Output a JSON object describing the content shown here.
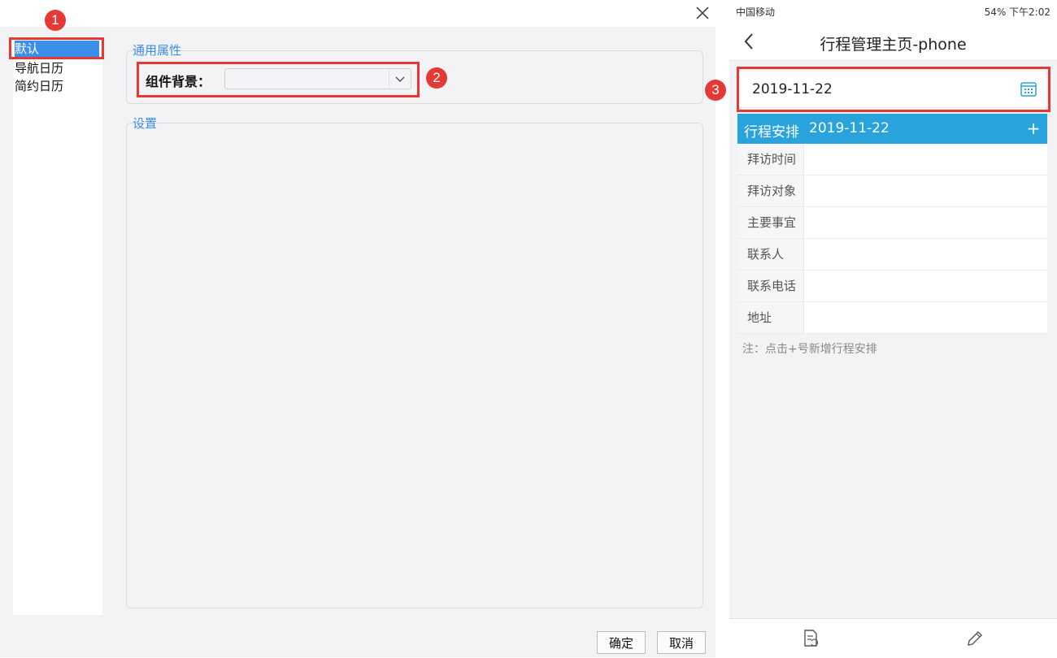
{
  "dialog": {
    "list_items": [
      "默认",
      "导航日历",
      "简约日历"
    ],
    "general_section_label": "通用属性",
    "background_label": "组件背景：",
    "background_value": "",
    "settings_section_label": "设置",
    "ok_label": "确定",
    "cancel_label": "取消"
  },
  "phone": {
    "status_left": "中国移动",
    "status_right": "54%  下午2:02",
    "title": "行程管理主页-phone",
    "date_value": "2019-11-22",
    "schedule_title": "行程安排",
    "schedule_date": "2019-11-22",
    "add_label": "+",
    "fields": [
      "拜访时间",
      "拜访对象",
      "主要事宜",
      "联系人",
      "联系电话",
      "地址"
    ],
    "note": "注：点击+号新增行程安排"
  },
  "annotations": [
    "1",
    "2",
    "3"
  ],
  "colors": {
    "accent": "#29a3db",
    "highlight": "#e53935",
    "link_blue": "#3e8ee0"
  }
}
